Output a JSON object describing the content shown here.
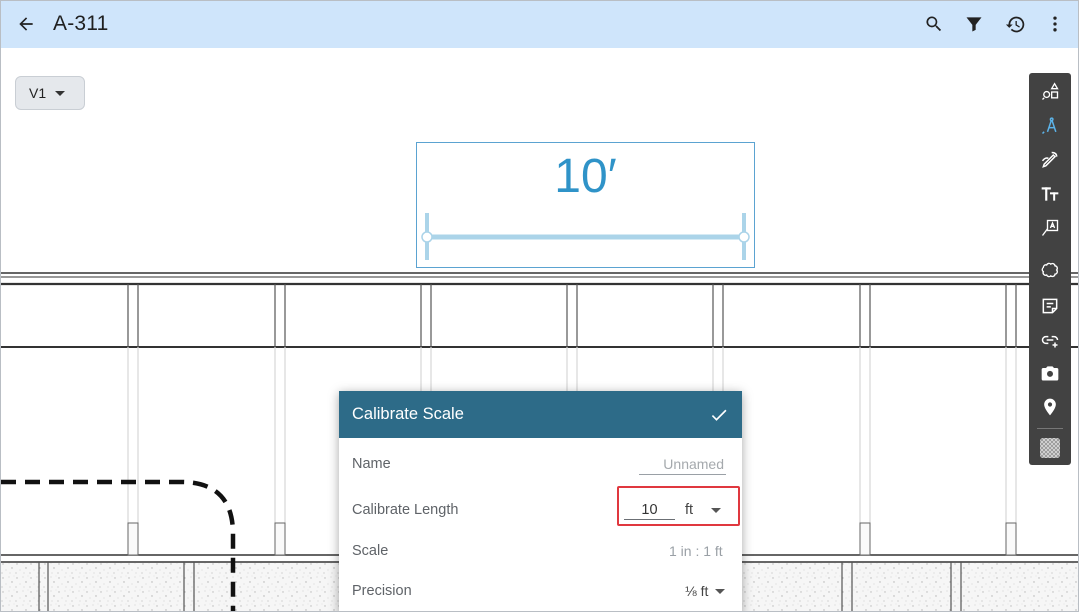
{
  "header": {
    "title": "A-311",
    "back_icon": "arrow-left-icon",
    "actions": [
      "search-icon",
      "filter-icon",
      "history-icon",
      "more-vert-icon"
    ],
    "background": "#cfe5fb"
  },
  "version": {
    "label": "V1"
  },
  "measurement": {
    "label": "10′",
    "color": "#2f93c8"
  },
  "toolbar": {
    "tools": [
      "shapes-icon",
      "measure-icon",
      "pen-icon",
      "text-icon",
      "callout-icon",
      "cloud-icon",
      "note-icon",
      "link-icon",
      "camera-icon",
      "pin-icon",
      "fill-pattern-icon"
    ],
    "background": "#424242"
  },
  "dialog": {
    "title": "Calibrate Scale",
    "header_color": "#2d6b88",
    "name": {
      "label": "Name",
      "value": "",
      "placeholder": "Unnamed"
    },
    "calibrate_length": {
      "label": "Calibrate Length",
      "value": "10",
      "unit": "ft",
      "highlight_color": "#e0383f"
    },
    "scale": {
      "label": "Scale",
      "value": "1 in : 1 ft"
    },
    "precision": {
      "label": "Precision",
      "value": "⅛ ft"
    }
  }
}
